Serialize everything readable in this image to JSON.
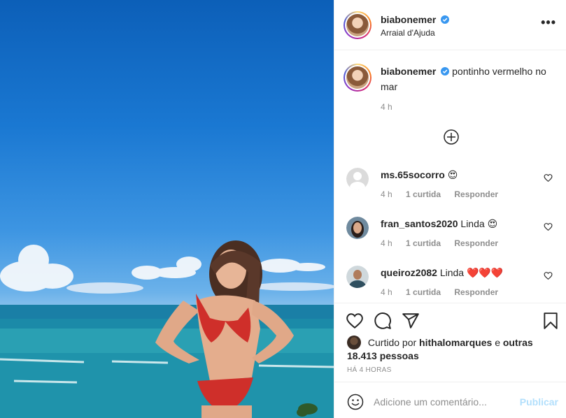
{
  "post": {
    "username": "biabonemer",
    "location": "Arraial d'Ajuda",
    "caption_text": "pontinho vermelho no mar",
    "caption_time": "4 h"
  },
  "comments": [
    {
      "username": "ms.65socorro",
      "text": "",
      "emoji": "😍",
      "time": "4 h",
      "likes": "1 curtida",
      "reply": "Responder"
    },
    {
      "username": "fran_santos2020",
      "text": "Linda",
      "emoji": "😍",
      "time": "4 h",
      "likes": "1 curtida",
      "reply": "Responder"
    },
    {
      "username": "queiroz2082",
      "text": "Linda",
      "emoji": "❤️❤️❤️",
      "time": "4 h",
      "likes": "1 curtida",
      "reply": "Responder"
    }
  ],
  "likes": {
    "prefix": "Curtido por",
    "user": "hithalomarques",
    "conj": "e",
    "others": "outras 18.413 pessoas"
  },
  "posted_ago": "HÁ 4 HORAS",
  "add_comment": {
    "placeholder": "Adicione um comentário...",
    "publish_label": "Publicar"
  },
  "colors": {
    "verified": "#3897f0",
    "meta_gray": "#8e8e8e",
    "publish_disabled": "#b2dffc",
    "heart_red": "#ed4956"
  }
}
